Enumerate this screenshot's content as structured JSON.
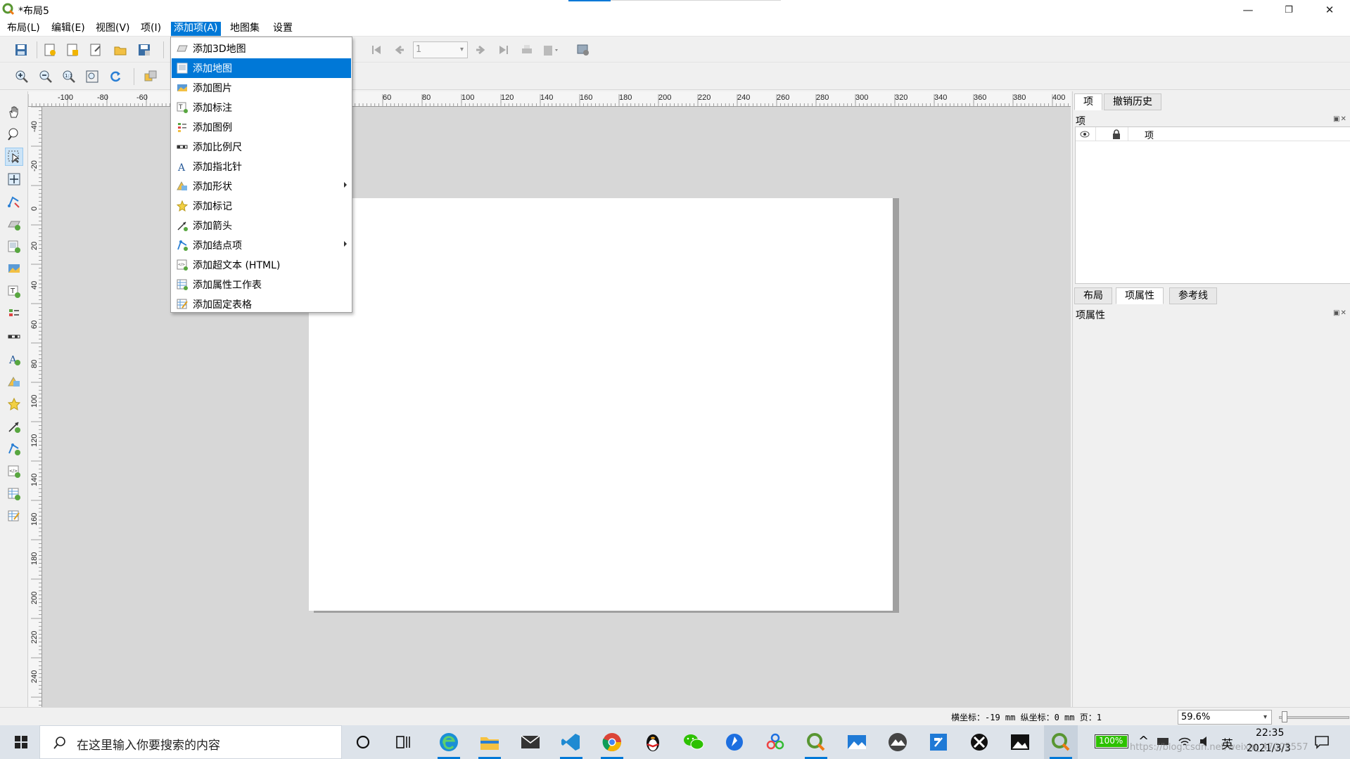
{
  "window": {
    "title": "*布局5",
    "minimize": "—",
    "restore": "❐",
    "close": "✕"
  },
  "menubar": {
    "items": [
      "布局(L)",
      "编辑(E)",
      "视图(V)",
      "项(I)",
      "添加项(A)",
      "地图集",
      "设置"
    ],
    "active_index": 4
  },
  "toolbar": {
    "page_field_value": "1"
  },
  "ruler": {
    "h_ticks": [
      "-100",
      "-80",
      "-60",
      "60",
      "80",
      "100",
      "120",
      "140",
      "160",
      "180",
      "200",
      "220",
      "240",
      "260",
      "280",
      "300",
      "320",
      "340",
      "360",
      "380",
      "400"
    ],
    "v_ticks": [
      "-40",
      "-20",
      "0",
      "20",
      "40",
      "60",
      "80",
      "100",
      "120",
      "140",
      "160",
      "180",
      "200",
      "220",
      "240"
    ]
  },
  "dropdown": {
    "items": [
      {
        "label": "添加3D地图",
        "icon": "3d-map-icon",
        "submenu": false
      },
      {
        "label": "添加地图",
        "icon": "map-icon",
        "submenu": false,
        "highlighted": true
      },
      {
        "label": "添加图片",
        "icon": "picture-icon",
        "submenu": false
      },
      {
        "label": "添加标注",
        "icon": "label-icon",
        "submenu": false
      },
      {
        "label": "添加图例",
        "icon": "legend-icon",
        "submenu": false
      },
      {
        "label": "添加比例尺",
        "icon": "scalebar-icon",
        "submenu": false
      },
      {
        "label": "添加指北针",
        "icon": "north-arrow-icon",
        "submenu": false
      },
      {
        "label": "添加形状",
        "icon": "shape-icon",
        "submenu": true
      },
      {
        "label": "添加标记",
        "icon": "marker-icon",
        "submenu": false
      },
      {
        "label": "添加箭头",
        "icon": "arrow-icon",
        "submenu": false
      },
      {
        "label": "添加结点项",
        "icon": "node-item-icon",
        "submenu": true
      },
      {
        "label": "添加超文本 (HTML)",
        "icon": "html-icon",
        "submenu": false
      },
      {
        "label": "添加属性工作表",
        "icon": "attribute-table-icon",
        "submenu": false
      },
      {
        "label": "添加固定表格",
        "icon": "fixed-table-icon",
        "submenu": false
      }
    ]
  },
  "right_panel": {
    "top_tabs": [
      "项",
      "撤销历史"
    ],
    "items_title": "项",
    "items_columns": {
      "visible": "",
      "lock": "",
      "name": "项"
    },
    "bottom_tabs": [
      "布局",
      "项属性",
      "参考线"
    ],
    "props_title": "项属性"
  },
  "statusbar": {
    "coords": "横坐标：-19 mm 纵坐标：0 mm  页：1",
    "zoom": "59.6%"
  },
  "taskbar": {
    "search_placeholder": "在这里输入你要搜索的内容",
    "battery": "100%",
    "ime": "英",
    "time": "22:35",
    "date": "2021/3/3",
    "watermark": "https://blog.csdn.net/weixin_47005557"
  },
  "colors": {
    "accent": "#0078d7",
    "qgis_green": "#589632"
  }
}
